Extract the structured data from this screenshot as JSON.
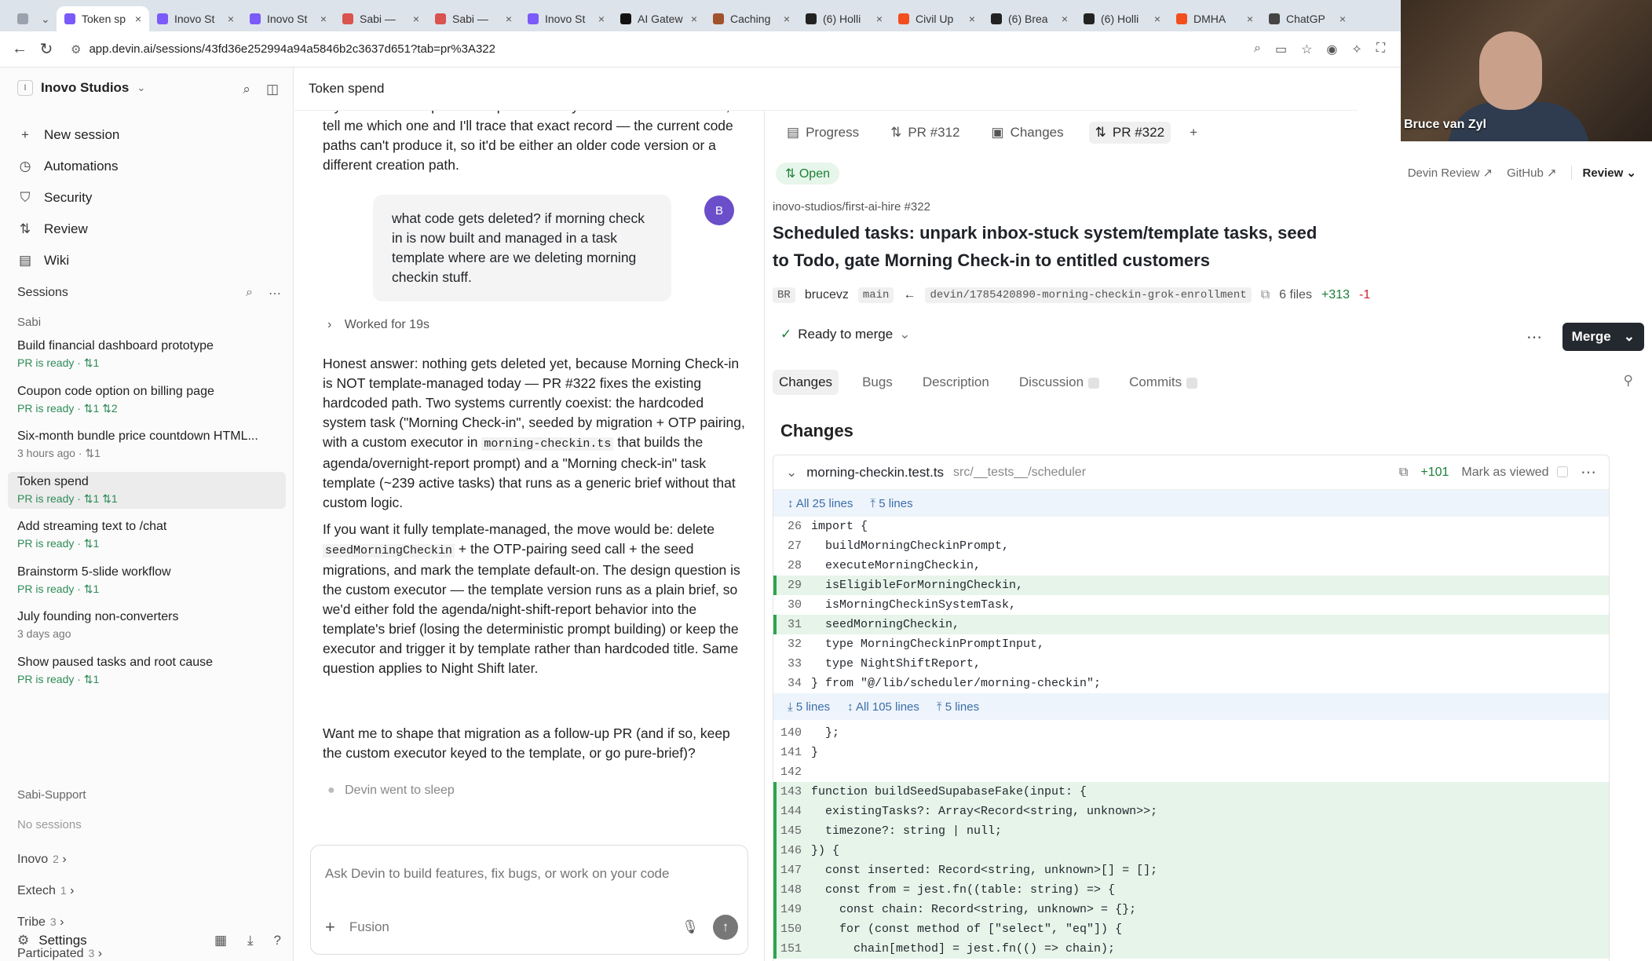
{
  "browser": {
    "tabs": [
      {
        "title": "",
        "icon": "grid-icon",
        "color": "#9aa3ad"
      },
      {
        "title": "Token sp",
        "icon": "devin-icon",
        "color": "#7a5af8",
        "active": true
      },
      {
        "title": "Inovo St",
        "icon": "devin-icon",
        "color": "#7a5af8"
      },
      {
        "title": "Inovo St",
        "icon": "devin-icon",
        "color": "#7a5af8"
      },
      {
        "title": "Sabi — ",
        "icon": "sabi-icon",
        "color": "#d9534f"
      },
      {
        "title": "Sabi — ",
        "icon": "sabi-icon",
        "color": "#d9534f"
      },
      {
        "title": "Inovo St",
        "icon": "devin-icon",
        "color": "#7a5af8"
      },
      {
        "title": "AI Gatew",
        "icon": "vercel-icon",
        "color": "#111111"
      },
      {
        "title": "Caching",
        "icon": "anthropic-icon",
        "color": "#a0522d"
      },
      {
        "title": "(6) Holli",
        "icon": "linkedin-icon",
        "color": "#222222"
      },
      {
        "title": "Civil Up",
        "icon": "figma-icon",
        "color": "#f24e1e"
      },
      {
        "title": "(6) Brea",
        "icon": "notion-icon",
        "color": "#222222"
      },
      {
        "title": "(6) Holli",
        "icon": "linkedin-icon",
        "color": "#222222"
      },
      {
        "title": "DMHA",
        "icon": "figma-icon",
        "color": "#f24e1e"
      },
      {
        "title": "ChatGP",
        "icon": "chatgpt-icon",
        "color": "#444444"
      }
    ],
    "url": "app.devin.ai/sessions/43fd36e252994a94a5846b2c3637d651?tab=pr%3A322"
  },
  "video": {
    "name": "Bruce van Zyl"
  },
  "sidebar": {
    "workspace": "Inovo Studios",
    "workspace_badge": "I",
    "nav": [
      {
        "label": "New session",
        "icon": "plus-icon"
      },
      {
        "label": "Automations",
        "icon": "automations-icon"
      },
      {
        "label": "Security",
        "icon": "shield-icon"
      },
      {
        "label": "Review",
        "icon": "review-icon"
      },
      {
        "label": "Wiki",
        "icon": "book-icon"
      }
    ],
    "sessions_label": "Sessions",
    "group_sabi": "Sabi",
    "sessions": [
      {
        "title": "Build financial dashboard prototype",
        "meta": "PR is ready · ⇅1"
      },
      {
        "title": "Coupon code option on billing page",
        "meta": "PR is ready · ⇅1 ⇅2"
      },
      {
        "title": "Six-month bundle price countdown HTML...",
        "meta": "3 hours ago · ⇅1"
      },
      {
        "title": "Token spend",
        "meta": "PR is ready · ⇅1 ⇅1"
      },
      {
        "title": "Add streaming text to /chat",
        "meta": "PR is ready · ⇅1"
      },
      {
        "title": "Brainstorm 5-slide workflow",
        "meta": "PR is ready · ⇅1"
      },
      {
        "title": "July founding non-converters",
        "meta": "3 days ago"
      },
      {
        "title": "Show paused tasks and root cause",
        "meta": "PR is ready · ⇅1"
      }
    ],
    "group_support": "Sabi-Support",
    "no_sessions": "No sessions",
    "collapsed": [
      {
        "label": "Inovo",
        "count": "2"
      },
      {
        "label": "Extech",
        "count": "1"
      },
      {
        "label": "Tribe",
        "count": "3"
      },
      {
        "label": "Participated",
        "count": "3"
      }
    ],
    "settings": "Settings"
  },
  "chat": {
    "header": "Token spend",
    "intro": "If you enabled a specific template recently and saw it land in Inbox, tell me which one and I'll trace that exact record — the current code paths can't produce it, so it'd be either an older code version or a different creation path.",
    "user_message": "what code gets deleted? if morning check in is now built and managed in a task template where are we deleting morning checkin stuff.",
    "user_initial": "B",
    "worked": "Worked for 19s",
    "p1_a": "Honest answer: nothing gets deleted yet, because Morning Check-in is NOT template-managed today — PR #322 fixes the existing hardcoded path. Two systems currently coexist: the hardcoded system task (\"Morning Check-in\", seeded by migration + OTP pairing, with a custom executor in ",
    "p1_code": "morning-checkin.ts",
    "p1_b": " that builds the agenda/overnight-report prompt) and a \"Morning check-in\" task template (~239 active tasks) that runs as a generic brief without that custom logic.",
    "p2_a": "If you want it fully template-managed, the move would be: delete ",
    "p2_code": "seedMorningCheckin",
    "p2_b": " + the OTP-pairing seed call + the seed migrations, and mark the template default-on. The design question is the custom executor — the template version runs as a plain brief, so we'd either fold the agenda/night-shift-report behavior into the template's brief (losing the deterministic prompt building) or keep the executor and trigger it by template rather than hardcoded title. Same question applies to Night Shift later.",
    "p3": "Want me to shape that migration as a follow-up PR (and if so, keep the custom executor keyed to the template, or go pure-brief)?",
    "sleep": "Devin went to sleep",
    "composer_placeholder": "Ask Devin to build features, fix bugs, or work on your code",
    "model": "Fusion"
  },
  "pr": {
    "tabs": [
      {
        "label": "Progress",
        "icon": "progress-icon"
      },
      {
        "label": "PR #312",
        "icon": "pr-icon"
      },
      {
        "label": "Changes",
        "icon": "changes-icon"
      },
      {
        "label": "PR #322",
        "icon": "pr-icon",
        "active": true
      }
    ],
    "status": "Open",
    "devin_review": "Devin Review ↗",
    "github": "GitHub ↗",
    "review": "Review",
    "repo": "inovo-studios/first-ai-hire #322",
    "title": "Scheduled tasks: unpark inbox-stuck system/template tasks, seed to Todo, gate Morning Check-in to entitled customers",
    "author_initials": "BR",
    "author": "brucevz",
    "base": "main",
    "head": "devin/1785420890-morning-checkin-grok-enrollment",
    "files": "6 files",
    "additions": "+313",
    "deletions": "-1",
    "merge_status": "Ready to merge",
    "merge": "Merge",
    "subtabs": [
      "Changes",
      "Bugs",
      "Description",
      "Discussion",
      "Commits"
    ],
    "changes_heading": "Changes",
    "file": {
      "name": "morning-checkin.test.ts",
      "path": "src/__tests__/scheduler",
      "additions": "+101",
      "mark_viewed": "Mark as viewed",
      "expand1": [
        "All 25 lines",
        "5 lines"
      ],
      "expand2": [
        "5 lines",
        "All 105 lines",
        "5 lines"
      ],
      "lines_a": [
        {
          "n": "26",
          "code": "import {",
          "added": false
        },
        {
          "n": "27",
          "code": "  buildMorningCheckinPrompt,",
          "added": false
        },
        {
          "n": "28",
          "code": "  executeMorningCheckin,",
          "added": false
        },
        {
          "n": "29",
          "code": "  isEligibleForMorningCheckin,",
          "added": true
        },
        {
          "n": "30",
          "code": "  isMorningCheckinSystemTask,",
          "added": false
        },
        {
          "n": "31",
          "code": "  seedMorningCheckin,",
          "added": true
        },
        {
          "n": "32",
          "code": "  type MorningCheckinPromptInput,",
          "added": false
        },
        {
          "n": "33",
          "code": "  type NightShiftReport,",
          "added": false
        },
        {
          "n": "34",
          "code": "} from \"@/lib/scheduler/morning-checkin\";",
          "added": false
        }
      ],
      "lines_b": [
        {
          "n": "140",
          "code": "  };",
          "added": false
        },
        {
          "n": "141",
          "code": "}",
          "added": false
        },
        {
          "n": "142",
          "code": "",
          "added": false
        },
        {
          "n": "143",
          "code": "function buildSeedSupabaseFake(input: {",
          "added": true
        },
        {
          "n": "144",
          "code": "  existingTasks?: Array<Record<string, unknown>>;",
          "added": true
        },
        {
          "n": "145",
          "code": "  timezone?: string | null;",
          "added": true
        },
        {
          "n": "146",
          "code": "}) {",
          "added": true
        },
        {
          "n": "147",
          "code": "  const inserted: Record<string, unknown>[] = [];",
          "added": true
        },
        {
          "n": "148",
          "code": "  const from = jest.fn((table: string) => {",
          "added": true
        },
        {
          "n": "149",
          "code": "    const chain: Record<string, unknown> = {};",
          "added": true
        },
        {
          "n": "150",
          "code": "    for (const method of [\"select\", \"eq\"]) {",
          "added": true
        },
        {
          "n": "151",
          "code": "      chain[method] = jest.fn(() => chain);",
          "added": true
        }
      ]
    }
  }
}
